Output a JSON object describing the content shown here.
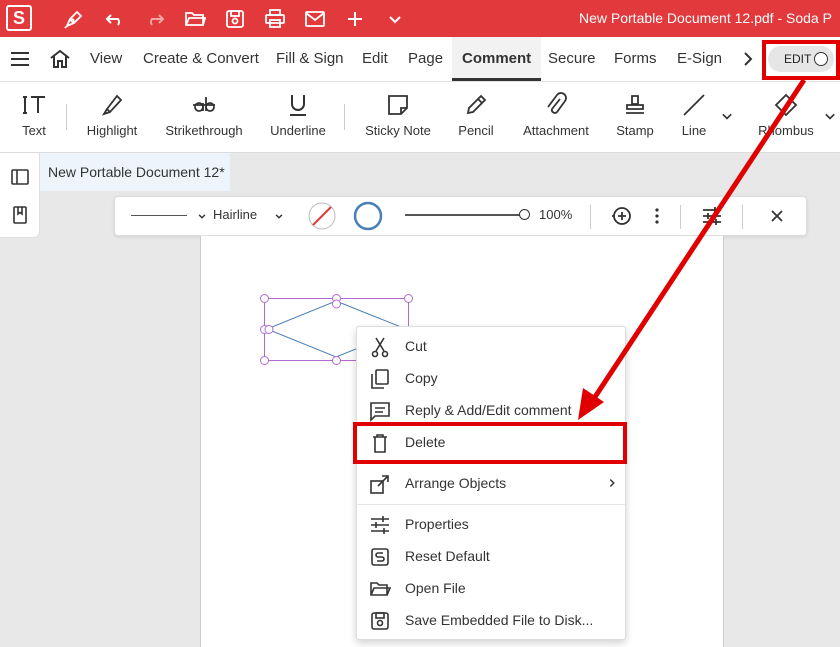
{
  "titlebar": {
    "app_logo": "S",
    "doc_title": "New Portable Document 12.pdf  -  Soda P",
    "icons": [
      "pen-icon",
      "undo-icon",
      "redo-icon",
      "open-folder-icon",
      "save-icon",
      "print-icon",
      "mail-icon",
      "plus-icon",
      "chevron-down-icon"
    ],
    "color": "#e2393c"
  },
  "menubar": {
    "items": [
      "View",
      "Create & Convert",
      "Fill & Sign",
      "Edit",
      "Page",
      "Comment",
      "Secure",
      "Forms",
      "E-Sign"
    ],
    "active": "Comment",
    "edit_toggle": "EDIT"
  },
  "toolbar": {
    "tools": [
      "Text",
      "Highlight",
      "Strikethrough",
      "Underline",
      "Sticky Note",
      "Pencil",
      "Attachment",
      "Stamp",
      "Line",
      "Rhombus"
    ]
  },
  "doc_tab": {
    "label": "New Portable Document 12*"
  },
  "propbar": {
    "line_style": "Hairline",
    "opacity": "100%"
  },
  "context_menu": {
    "items": [
      {
        "label": "Cut",
        "icon": "scissors-icon"
      },
      {
        "label": "Copy",
        "icon": "copy-icon"
      },
      {
        "label": "Reply & Add/Edit comment",
        "icon": "comment-icon"
      },
      {
        "label": "Delete",
        "icon": "trash-icon"
      },
      {
        "label": "Arrange Objects",
        "icon": "arrange-icon"
      },
      {
        "label": "Properties",
        "icon": "sliders-icon"
      },
      {
        "label": "Reset Default",
        "icon": "reset-icon"
      },
      {
        "label": "Open File",
        "icon": "open-folder-icon"
      },
      {
        "label": "Save Embedded File to Disk...",
        "icon": "save-icon"
      }
    ]
  },
  "annotation": {
    "highlight_color": "#e00000"
  }
}
